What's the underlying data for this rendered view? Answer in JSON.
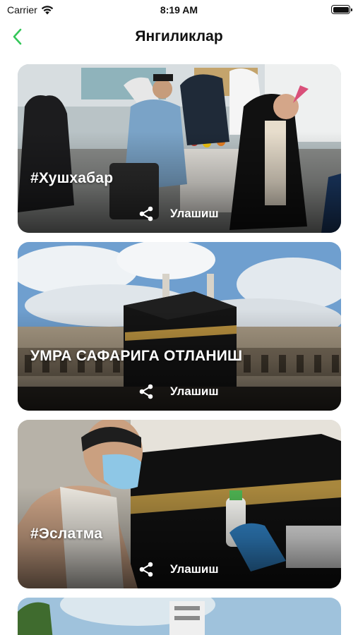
{
  "status_bar": {
    "carrier": "Carrier",
    "time": "8:19 AM",
    "icons": [
      "wifi-icon",
      "battery-icon"
    ]
  },
  "nav": {
    "title": "Янгиликлар",
    "back_icon": "chevron-left-icon",
    "accent_color": "#34C759"
  },
  "news": [
    {
      "title": "#Хушхабар",
      "share_label": "Улашиш",
      "share_icon": "share-icon",
      "image": "pilgrims-airport-welcome-photo"
    },
    {
      "title": "УМРА САФАРИГА ОТЛАНИШ",
      "share_label": "Улашиш",
      "share_icon": "share-icon",
      "image": "kaaba-photo"
    },
    {
      "title": "#Эслатма",
      "share_label": "Улашиш",
      "share_icon": "share-icon",
      "image": "masked-pilgrim-sanitizer-photo"
    }
  ]
}
